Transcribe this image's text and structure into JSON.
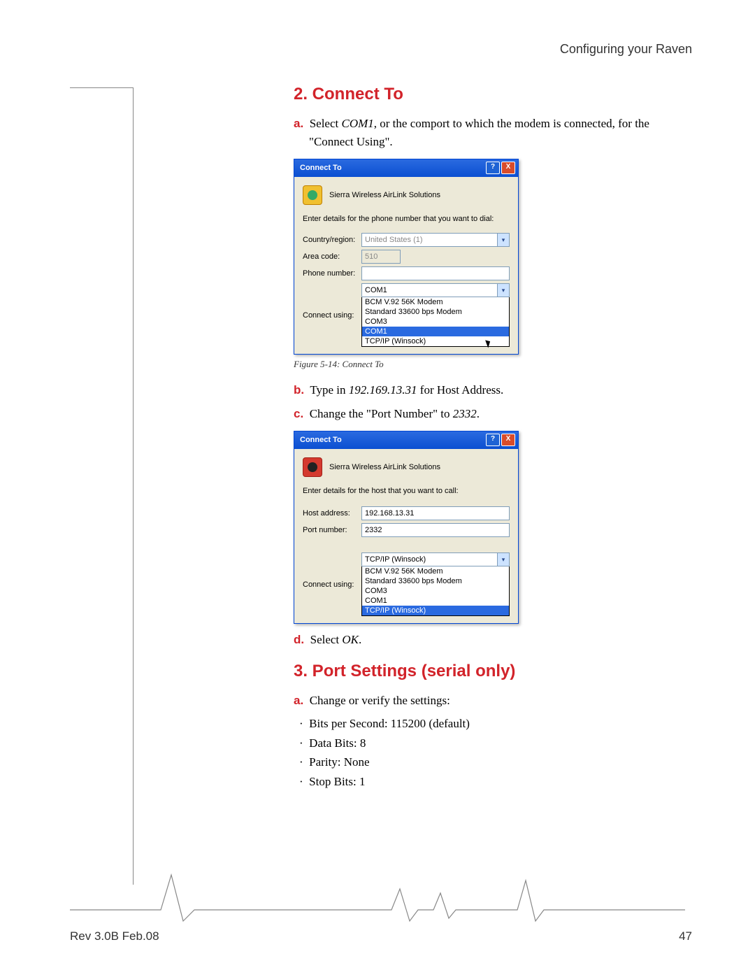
{
  "header": {
    "running": "Configuring your Raven"
  },
  "h2_connect": "2. Connect To",
  "steps1": {
    "a": {
      "l": "a.",
      "pre": "Select ",
      "em": "COM1",
      "post": ", or the comport to which the modem is connected, for the \"Connect Using\"."
    }
  },
  "dialog1": {
    "title": "Connect To",
    "appname": "Sierra Wireless AirLink Solutions",
    "prompt": "Enter details for the phone number that you want to dial:",
    "labels": {
      "country": "Country/region:",
      "area": "Area code:",
      "phone": "Phone number:",
      "using": "Connect using:"
    },
    "values": {
      "country": "United States (1)",
      "area": "510",
      "phone": "",
      "using": "COM1"
    },
    "opts": [
      "BCM V.92 56K Modem",
      "Standard 33600 bps Modem",
      "COM3",
      "COM1",
      "TCP/IP (Winsock)"
    ],
    "highlight": 3
  },
  "cap1": "Figure 5-14:  Connect To",
  "steps2": {
    "b": {
      "l": "b.",
      "pre": "Type in ",
      "em": "192.169.13.31",
      "post": " for Host Address."
    },
    "c": {
      "l": "c.",
      "txt": "Change the \"Port Number\" to ",
      "em": "2332",
      "post": "."
    }
  },
  "dialog2": {
    "title": "Connect To",
    "appname": "Sierra Wireless AirLink Solutions",
    "prompt": "Enter details for the host that you want to call:",
    "labels": {
      "host": "Host address:",
      "port": "Port number:",
      "using": "Connect using:"
    },
    "values": {
      "host": "192.168.13.31",
      "port": "2332",
      "using": "TCP/IP (Winsock)"
    },
    "opts": [
      "BCM V.92 56K Modem",
      "Standard 33600 bps Modem",
      "COM3",
      "COM1",
      "TCP/IP (Winsock)"
    ],
    "highlight": 4
  },
  "steps3": {
    "d": {
      "l": "d.",
      "pre": "Select ",
      "em": "OK",
      "post": "."
    }
  },
  "h2_port": "3. Port Settings (serial only)",
  "steps4": {
    "a": {
      "l": "a.",
      "txt": "Change or verify the settings:"
    }
  },
  "bullets": [
    "Bits per Second: 115200 (default)",
    "Data Bits: 8",
    "Parity: None",
    "Stop Bits: 1"
  ],
  "footer": {
    "rev": "Rev 3.0B  Feb.08",
    "page": "47"
  },
  "btn": {
    "help": "?",
    "close": "X",
    "chev": "▾"
  },
  "dot": "·"
}
